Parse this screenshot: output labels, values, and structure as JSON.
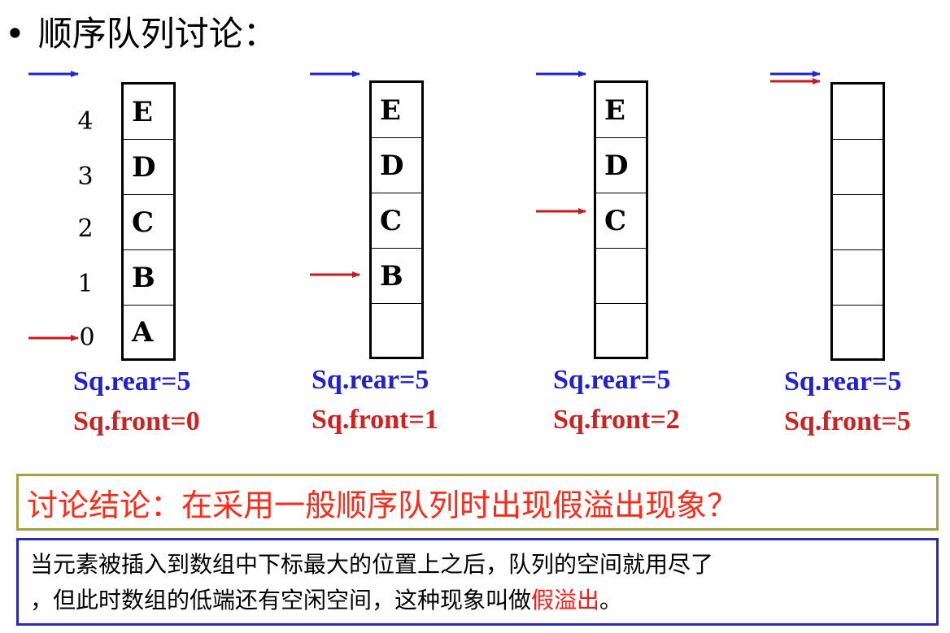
{
  "title": {
    "bullet": "•",
    "text": "顺序队列讨论："
  },
  "index_labels": [
    "4",
    "3",
    "2",
    "1",
    "0"
  ],
  "queues": [
    {
      "cells": [
        "E",
        "D",
        "C",
        "B",
        "A"
      ],
      "rear_label": "Sq.rear=5",
      "front_label": "Sq.front=0"
    },
    {
      "cells": [
        "E",
        "D",
        "C",
        "B",
        ""
      ],
      "rear_label": "Sq.rear=5",
      "front_label": "Sq.front=1"
    },
    {
      "cells": [
        "E",
        "D",
        "C",
        "",
        ""
      ],
      "rear_label": "Sq.rear=5",
      "front_label": "Sq.front=2"
    },
    {
      "cells": [
        "",
        "",
        "",
        "",
        ""
      ],
      "rear_label": "Sq.rear=5",
      "front_label": "Sq.front=5"
    }
  ],
  "colors": {
    "rear_arrow": "#2222cc",
    "front_arrow": "#cc1a1a",
    "conclusion_text": "#ff2b1a",
    "conclusion_border": "#a8a040",
    "explain_border": "#2a2ab8",
    "highlight": "#ff1a1a"
  },
  "conclusion": "讨论结论：在采用一般顺序队列时出现假溢出现象？",
  "explanation": {
    "line1": "当元素被插入到数组中下标最大的位置上之后，队列的空间就用尽了",
    "line2_before": "，但此时数组的低端还有空闲空间，这种现象叫做",
    "line2_highlight": "假溢出",
    "line2_after": "。"
  }
}
